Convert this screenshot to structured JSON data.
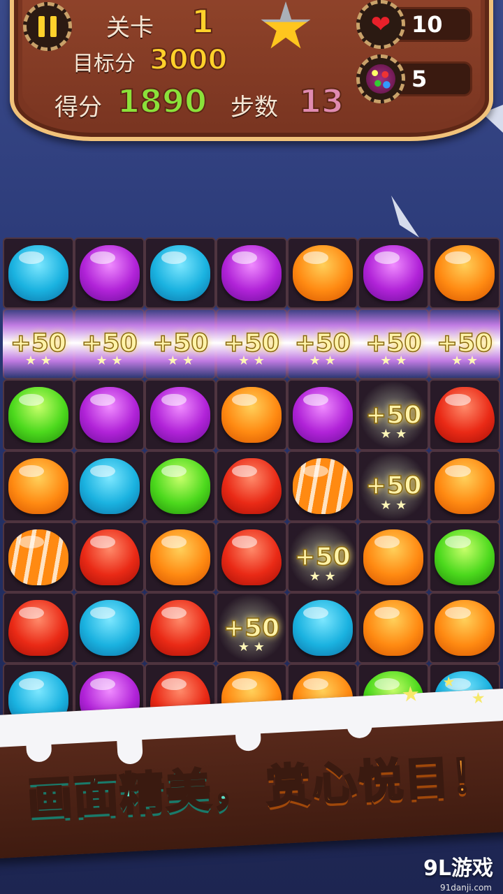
{
  "hud": {
    "level_label": "关卡",
    "level_value": "1",
    "target_label": "目标分",
    "target_value": "3000",
    "score_label": "得分",
    "score_value": "1890",
    "steps_label": "步数",
    "steps_value": "13",
    "lives_value": "10",
    "bombs_value": "5"
  },
  "board": {
    "rows": [
      [
        "blue",
        "purple",
        "blue",
        "purple",
        "orange",
        "purple",
        "orange"
      ],
      [
        "pop",
        "pop",
        "pop",
        "pop",
        "pop",
        "pop",
        "pop"
      ],
      [
        "green",
        "purple",
        "purple",
        "orange",
        "purple",
        "pop",
        "red"
      ],
      [
        "orange",
        "blue",
        "green",
        "red",
        "striped",
        "pop",
        "orange"
      ],
      [
        "striped",
        "red",
        "orange",
        "red",
        "pop",
        "orange",
        "green"
      ],
      [
        "red",
        "blue",
        "red",
        "pop",
        "blue",
        "orange",
        "orange"
      ],
      [
        "blue",
        "purple",
        "red",
        "orange",
        "orange",
        "green",
        "blue"
      ]
    ],
    "pop_text": "+50",
    "sparkle_text": "★ ★"
  },
  "banner": {
    "text_left": "画面精美，",
    "text_right": "赏心悦目！"
  },
  "logo": {
    "text": "9L游戏",
    "url": "91danji.com"
  },
  "colors": {
    "hud_brown": "#7a3521",
    "hud_border": "#f1c27a",
    "score_green": "#8ae23a",
    "gold": "#ffd12b"
  }
}
